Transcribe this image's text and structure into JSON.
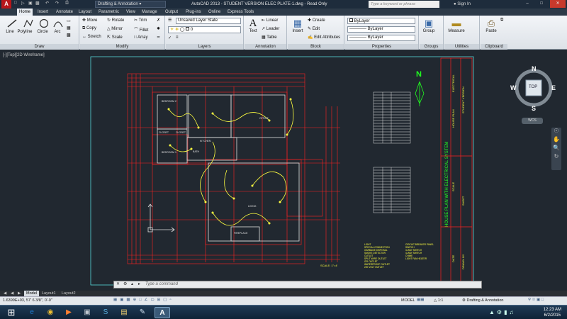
{
  "title_bar": {
    "app_letter": "A",
    "workspace": "Drafting & Annotation",
    "window_title": "AutoCAD 2013 - STUDENT VERSION    ELEC PLATE-1.dwg - Read Only",
    "search_placeholder": "Type a keyword or phrase",
    "sign_in": "Sign In"
  },
  "ribbon_tabs": [
    "Home",
    "Insert",
    "Annotate",
    "Layout",
    "Parametric",
    "View",
    "Manage",
    "Output",
    "Plug-ins",
    "Online",
    "Express Tools"
  ],
  "ribbon": {
    "draw": {
      "title": "Draw",
      "line": "Line",
      "polyline": "Polyline",
      "circle": "Circle",
      "arc": "Arc"
    },
    "modify": {
      "title": "Modify",
      "move": "Move",
      "rotate": "Rotate",
      "trim": "Trim",
      "copy": "Copy",
      "mirror": "Mirror",
      "fillet": "Fillet",
      "stretch": "Stretch",
      "scale": "Scale",
      "array": "Array"
    },
    "layers": {
      "title": "Layers",
      "state": "Unsaved Layer State",
      "current": "0"
    },
    "annotation": {
      "title": "Annotation",
      "text": "Text",
      "linear": "Linear",
      "leader": "Leader",
      "table": "Table"
    },
    "block": {
      "title": "Block",
      "insert": "Insert",
      "create": "Create",
      "edit": "Edit",
      "edit_attributes": "Edit Attributes"
    },
    "properties": {
      "title": "Properties",
      "color": "ByLayer",
      "linetype": "ByLayer",
      "lineweight": "ByLayer"
    },
    "groups": {
      "title": "Groups",
      "group": "Group"
    },
    "utilities": {
      "title": "Utilities",
      "measure": "Measure"
    },
    "clipboard": {
      "title": "Clipboard",
      "paste": "Paste"
    }
  },
  "viewport_label": "[-][Top][2D Wireframe]",
  "viewcube": {
    "top": "TOP",
    "n": "N",
    "s": "S",
    "e": "E",
    "w": "W",
    "wcs": "WCS"
  },
  "drawing": {
    "north": "N",
    "rooms": [
      "BEDROOM 2",
      "BEDROOM 1",
      "CLOSET",
      "CLOSET",
      "OFFICE",
      "LIVING",
      "FIREPLACE",
      "KITCHEN",
      "BATH"
    ],
    "scale_label": "SCALE: 1\"=4'",
    "plan_title": "HOUSE PLAN WITH ELECTRICAL SYSTEM"
  },
  "legend": {
    "left": [
      "LIGHT",
      "SPECIAL CONNECTION",
      "GARBAGE DISPOSAL",
      "SMOKE DETECTOR",
      "OUTLET",
      "SPLIT WIRE OUTLET",
      "GFI OUTLET",
      "WATERPROOF OUTLET",
      "220 VOLT OUTLET"
    ],
    "right": [
      "CIRCUIT BREAKER PANEL",
      "SWITCH",
      "3-WAY SWITCH",
      "4-WAY SWITCH",
      "CHIME",
      "LIGHT FAN HEATER"
    ]
  },
  "command_placeholder": "Type a command",
  "layout_tabs": [
    "Model",
    "Layout1",
    "Layout2"
  ],
  "status": {
    "coords": "1.6399E+03,   57' 6 3/8\", 0'-0\"",
    "model": "MODEL",
    "scale": "1:1",
    "workspace": "Drafting & Annotation"
  },
  "taskbar": {
    "time": "12:23 AM",
    "date": "6/2/2015"
  },
  "colors": {
    "accent_red": "#b8161a",
    "layout_red": "#ff2020",
    "cad_yellow": "#ffff40",
    "cad_green": "#20ff20",
    "cad_white": "#e0e0e0",
    "drawing_bg": "#212830"
  }
}
